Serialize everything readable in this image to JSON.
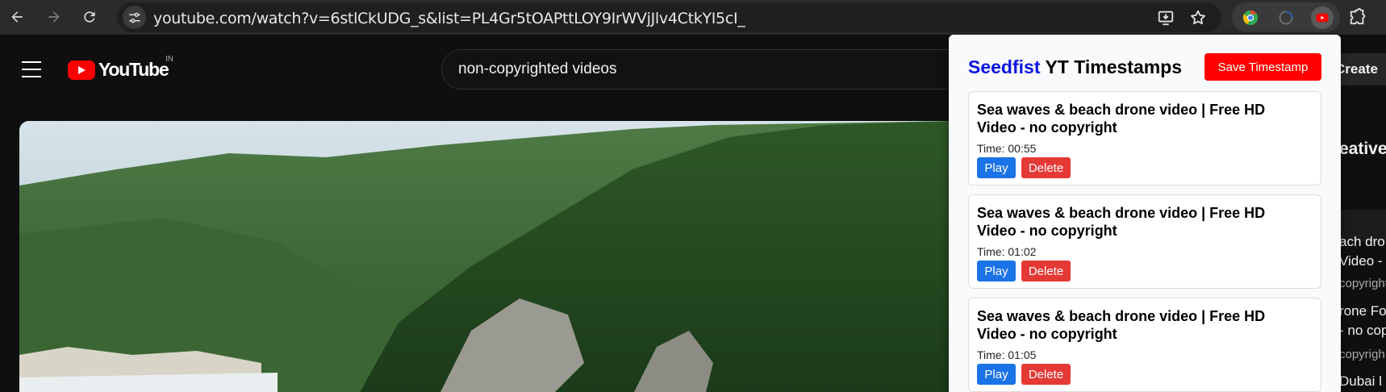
{
  "browser": {
    "url": "youtube.com/watch?v=6stlCkUDG_s&list=PL4Gr5tOAPttLOY9IrWVjJlv4CtkYI5cI_",
    "icons": {
      "back": "back-arrow-icon",
      "forward": "forward-arrow-icon",
      "reload": "reload-icon",
      "site_info": "tune-icon",
      "install": "install-app-icon",
      "bookmark": "star-icon",
      "extensions": "puzzle-icon"
    }
  },
  "youtube": {
    "logo_text": "YouTube",
    "region": "IN",
    "search_value": "non-copyrighted videos",
    "create_label": "Create",
    "sidebar": {
      "heading": "eative",
      "lines": [
        "ach dro",
        "Video - r",
        "copyright",
        "rone Fo",
        "- no cop",
        "copyrigh",
        "Dubai l"
      ]
    }
  },
  "extension": {
    "brand": "Seedfist",
    "title_rest": " YT Timestamps",
    "save_label": "Save Timestamp",
    "colors": {
      "brand": "#0b16e0",
      "save": "#ff0000",
      "play": "#1b73e8",
      "delete": "#e53935"
    },
    "timestamps": [
      {
        "title": "Sea waves & beach drone video | Free HD Video - no copyright",
        "time": "Time: 00:55",
        "play": "Play",
        "delete": "Delete"
      },
      {
        "title": "Sea waves & beach drone video | Free HD Video - no copyright",
        "time": "Time: 01:02",
        "play": "Play",
        "delete": "Delete"
      },
      {
        "title": "Sea waves & beach drone video | Free HD Video - no copyright",
        "time": "Time: 01:05",
        "play": "Play",
        "delete": "Delete"
      }
    ]
  }
}
